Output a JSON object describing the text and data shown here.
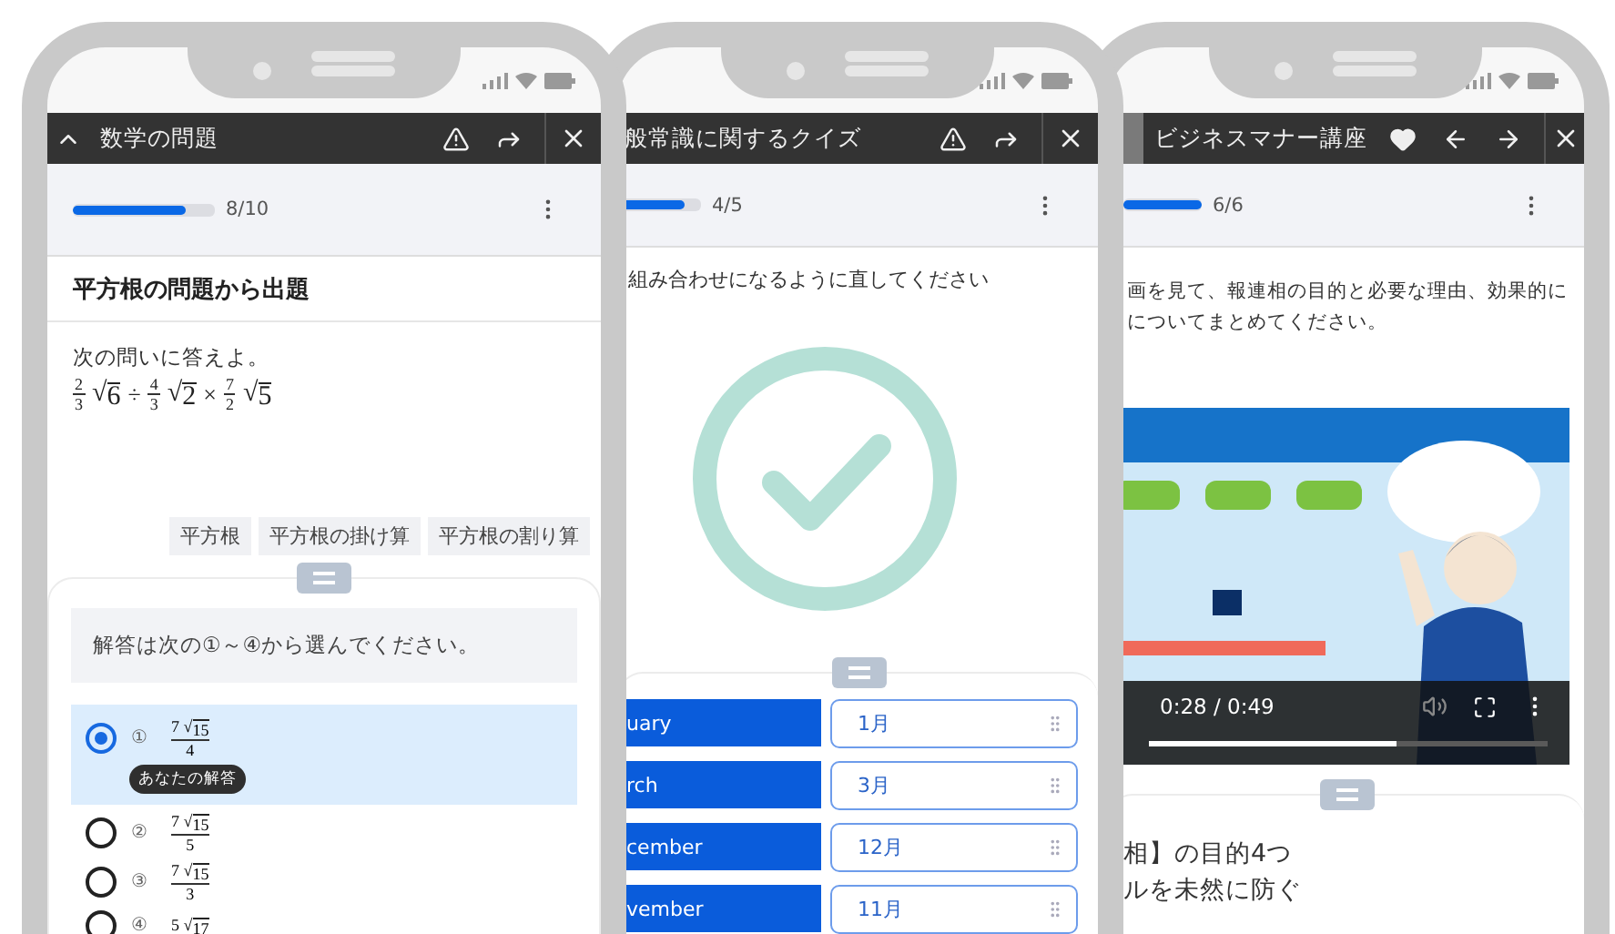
{
  "phones": [
    {
      "kind": "math",
      "title": "数学の問題",
      "progress": {
        "level": 0.8,
        "label": "8/10"
      },
      "section_title": "平方根の問題から出題",
      "prompt": "次の問いに答えよ。",
      "expression": [
        {
          "kind": "fraction",
          "num": "2",
          "den": "3"
        },
        {
          "kind": "sqrt",
          "sign": "√",
          "value": "6"
        },
        {
          "kind": "operator",
          "value": "÷"
        },
        {
          "kind": "fraction",
          "num": "4",
          "den": "3"
        },
        {
          "kind": "sqrt",
          "sign": "√",
          "value": "2"
        },
        {
          "kind": "operator",
          "value": "×"
        },
        {
          "kind": "fraction",
          "num": "7",
          "den": "2"
        },
        {
          "kind": "sqrt",
          "sign": "√",
          "value": "5"
        }
      ],
      "tags": [
        "平方根",
        "平方根の掛け算",
        "平方根の割り算"
      ],
      "instruction": "解答は次の①～④から選んでください。",
      "options": [
        {
          "marker": "①",
          "coefficient": "7",
          "sign": "√",
          "radicand": "15",
          "denominator": "4",
          "selected": true,
          "badge": "あなたの解答"
        },
        {
          "marker": "②",
          "coefficient": "7",
          "sign": "√",
          "radicand": "15",
          "denominator": "5",
          "selected": false
        },
        {
          "marker": "③",
          "coefficient": "7",
          "sign": "√",
          "radicand": "15",
          "denominator": "3",
          "selected": false
        },
        {
          "marker": "④",
          "coefficient": "5",
          "sign": "√",
          "radicand": "17",
          "selected": false
        }
      ]
    },
    {
      "kind": "matching",
      "title": "般常識に関するクイズ",
      "progress": {
        "level": 0.8,
        "label": "4/5"
      },
      "instruction": "組み合わせになるように直してください",
      "correct": true,
      "pairs": [
        {
          "left": "uary",
          "right": "1月"
        },
        {
          "left": "rch",
          "right": "3月"
        },
        {
          "left": "cember",
          "right": "12月"
        },
        {
          "left": "vember",
          "right": "11月"
        }
      ]
    },
    {
      "kind": "video",
      "title": "ビジネスマナー講座",
      "progress": {
        "level": 1,
        "label": "6/6"
      },
      "lines": [
        "画を見て、報連相の目的と必要な理由、効果的に",
        "についてまとめてください。"
      ],
      "video": {
        "kind": "picture",
        "time": "0:28 / 0:49",
        "level": 0.62
      },
      "notes": [
        "相】の目的4つ",
        "ルを未然に防ぐ"
      ]
    }
  ]
}
